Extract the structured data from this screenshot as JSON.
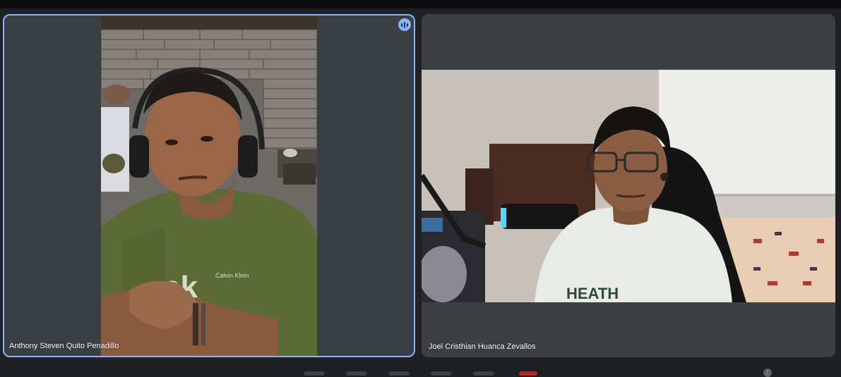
{
  "participants": [
    {
      "name": "Anthony Steven Quito Penadillo",
      "is_speaking": true,
      "shirt_text": "Calvin Klein"
    },
    {
      "name": "Joel Cristhian Huanca Zevallos",
      "is_speaking": false
    }
  ],
  "colors": {
    "background": "#202124",
    "tile_background": "#3c4043",
    "active_speaker_border": "#8ab4f8"
  },
  "icons": {
    "speaking_indicator": "audio-wave-icon",
    "more_options": "more-icon"
  }
}
